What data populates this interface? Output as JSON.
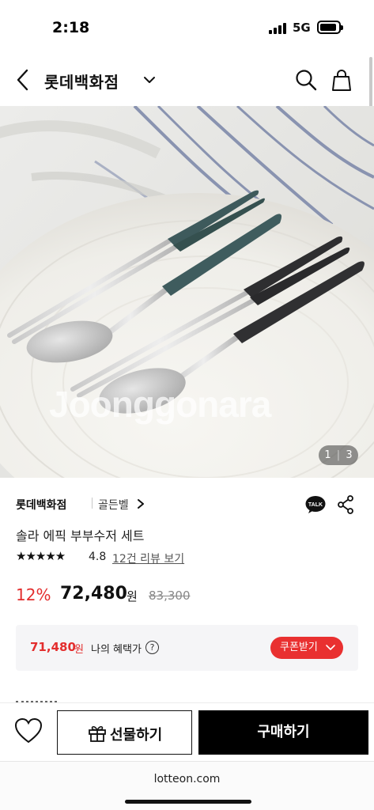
{
  "status_bar": {
    "time": "2:18",
    "network": "5G"
  },
  "header": {
    "title": "롯데백화점"
  },
  "gallery": {
    "watermark": "Joonggonara",
    "counter_current": "1",
    "counter_separator": "|",
    "counter_total": "3"
  },
  "product": {
    "brand": "롯데백화점",
    "sub_brand": "골든벨",
    "name": "솔라 에픽 부부수저 세트",
    "stars": "★★★★★",
    "rating": "4.8",
    "review_link": "12건 리뷰 보기",
    "discount": "12%",
    "price": "72,480",
    "price_unit": "원",
    "original_price": "83,300"
  },
  "benefit": {
    "price": "71,480",
    "price_unit": "원",
    "label": "나의 혜택가",
    "help": "?",
    "coupon_button": "쿠폰받기"
  },
  "bottom_bar": {
    "gift_button": "선물하기",
    "buy_button": "구매하기"
  },
  "browser": {
    "url": "lotteon.com"
  },
  "colors": {
    "accent_red": "#e32e2e",
    "coupon_red": "#e93030",
    "buy_black": "#000000",
    "chopstick_teal": "#3e5a5c",
    "chopstick_black": "#2e2e30"
  },
  "icons": {
    "back": "chevron-left-icon",
    "dropdown": "chevron-down-icon",
    "search": "search-icon",
    "bag": "shopping-bag-icon",
    "talk": "kakao-talk-icon",
    "share": "share-icon",
    "wishlist": "heart-icon",
    "gift": "gift-icon"
  }
}
